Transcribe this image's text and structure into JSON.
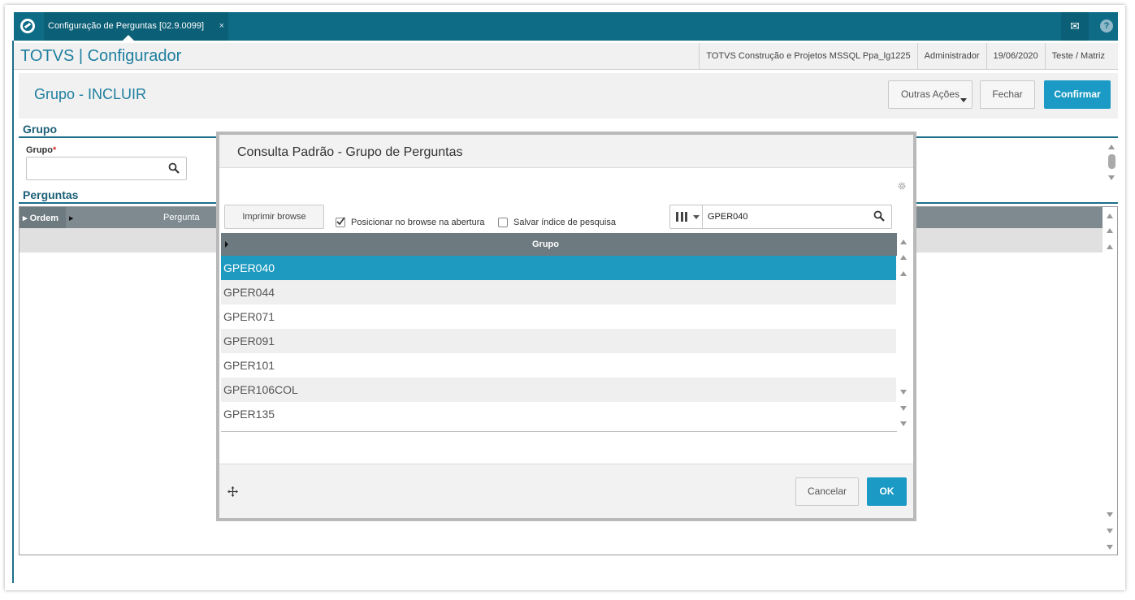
{
  "topbar": {
    "tab_label": "Configuração de Perguntas [02.9.0099]",
    "tab_close": "×"
  },
  "header": {
    "app_title": "TOTVS | Configurador",
    "environment": "TOTVS Construção e Projetos MSSQL Ppa_lg1225",
    "user": "Administrador",
    "date": "19/06/2020",
    "branch": "Teste / Matriz"
  },
  "page": {
    "title": "Grupo - INCLUIR",
    "outras_acoes": "Outras Ações",
    "fechar": "Fechar",
    "confirmar": "Confirmar"
  },
  "form": {
    "section_grupo": "Grupo",
    "grupo_label": "Grupo",
    "grupo_required": "*",
    "grupo_value": "",
    "section_perguntas": "Perguntas"
  },
  "grid": {
    "columns": [
      "Ordem",
      "Pergunta"
    ]
  },
  "modal": {
    "title": "Consulta Padrão - Grupo de Perguntas",
    "print_button": "Imprimir browse",
    "option_position": "Posicionar no browse na abertura",
    "option_position_checked": true,
    "option_save_index": "Salvar índice de pesquisa",
    "option_save_index_checked": false,
    "search_value": "GPER040",
    "column_header": "Grupo",
    "rows": [
      "GPER040",
      "GPER044",
      "GPER071",
      "GPER091",
      "GPER101",
      "GPER106COL",
      "GPER135"
    ],
    "selected_index": 0,
    "cancel_button": "Cancelar",
    "ok_button": "OK"
  },
  "colors": {
    "topbar": "#0e6c86",
    "accent": "#1a9ac4",
    "title": "#1e7f9f",
    "grid_header": "#6d7a80"
  },
  "icons": [
    "totvs-logo-icon",
    "mail-icon",
    "help-icon",
    "search-icon",
    "gear-icon",
    "columns-icon",
    "move-icon"
  ]
}
